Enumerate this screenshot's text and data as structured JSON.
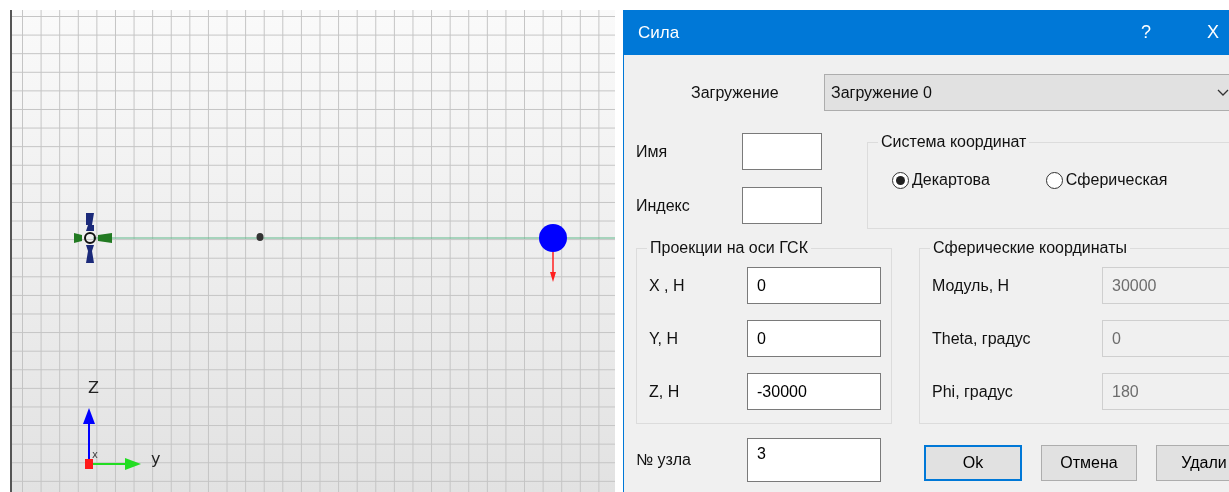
{
  "viewport": {
    "axes": {
      "z": "Z",
      "y": "y",
      "x": "x"
    }
  },
  "dialog": {
    "title": "Сила",
    "help_button": "?",
    "close_button": "X",
    "load_case": {
      "label": "Загружение",
      "value": "Загружение 0"
    },
    "name": {
      "label": "Имя"
    },
    "index": {
      "label": "Индекс"
    },
    "coordinate_system": {
      "title": "Система координат",
      "options": [
        {
          "label": "Декартова",
          "selected": true
        },
        {
          "label": "Сферическая",
          "selected": false
        }
      ]
    },
    "projections": {
      "title": "Проекции на оси  ГСК",
      "rows": [
        {
          "label": "X , H",
          "value": "0",
          "disabled": false
        },
        {
          "label": "Y, H",
          "value": "0",
          "disabled": false
        },
        {
          "label": "Z, H",
          "value": "-30000",
          "disabled": false
        }
      ]
    },
    "spherical": {
      "title": "Сферические координаты",
      "rows": [
        {
          "label": "Модуль, Н",
          "value": "30000",
          "disabled": true
        },
        {
          "label": "Theta, градус",
          "value": "0",
          "disabled": true
        },
        {
          "label": "Phi, градус",
          "value": "180",
          "disabled": true
        }
      ]
    },
    "node": {
      "label": "№ узла",
      "value": "3"
    },
    "buttons": [
      {
        "label": "Ok",
        "focused": true
      },
      {
        "label": "Отмена",
        "focused": false
      },
      {
        "label": "Удали",
        "focused": false
      }
    ]
  }
}
